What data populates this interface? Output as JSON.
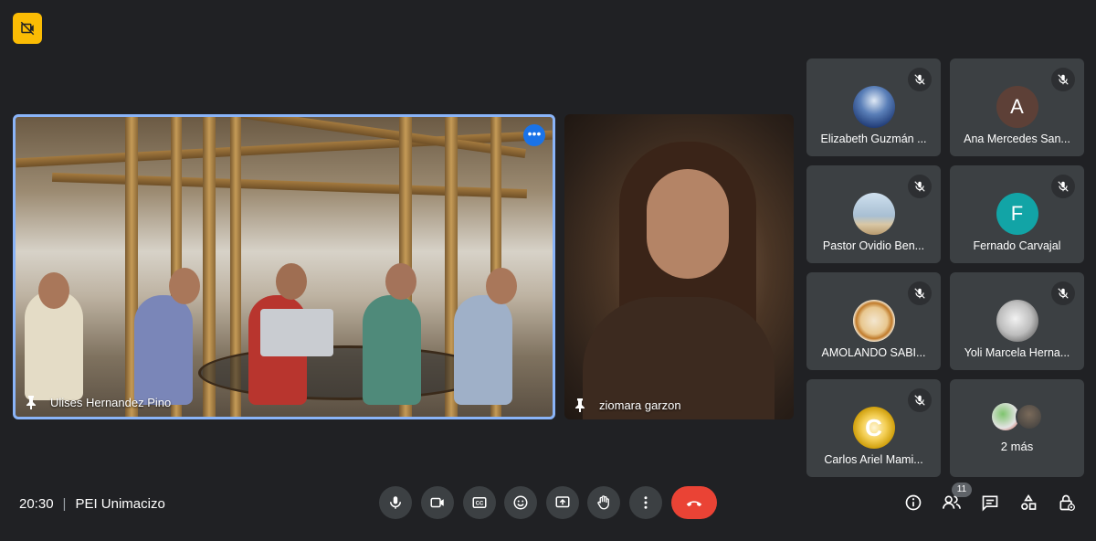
{
  "main_tile": {
    "name": "Ulises Hernandez Pino",
    "more_label": "•••"
  },
  "second_tile": {
    "name": "ziomara garzon"
  },
  "participants": [
    {
      "name": "Elizabeth Guzmán ...",
      "avatar_letter": "",
      "avatar_color": "#1f3a75"
    },
    {
      "name": "Ana Mercedes San...",
      "avatar_letter": "A",
      "avatar_color": "#5d4037"
    },
    {
      "name": "Pastor Ovidio Ben...",
      "avatar_letter": "",
      "avatar_color": "#9db3c9"
    },
    {
      "name": "Fernado Carvajal",
      "avatar_letter": "F",
      "avatar_color": "#12a4a6"
    },
    {
      "name": "AMOLANDO SABI...",
      "avatar_letter": "",
      "avatar_color": "#f3e6cf"
    },
    {
      "name": "Yoli Marcela Herna...",
      "avatar_letter": "",
      "avatar_color": "#d9d9d9"
    },
    {
      "name": "Carlos Ariel Mami...",
      "avatar_letter": "C",
      "avatar_color": "#d4a017"
    }
  ],
  "more_tile": {
    "label": "2 más"
  },
  "meeting": {
    "time": "20:30",
    "separator": "|",
    "code": "PEI Unimacizo"
  },
  "people_count": "11",
  "colors": {
    "background": "#202124",
    "tile": "#3c4043",
    "accent": "#8ab4f8",
    "end_call": "#ea4335",
    "recording": "#fbbc04"
  },
  "icons": {
    "recording": "no-camera-icon",
    "controls": [
      "mic-icon",
      "camera-icon",
      "captions-icon",
      "emoji-icon",
      "present-icon",
      "raise-hand-icon",
      "more-options-icon",
      "end-call-icon"
    ],
    "right": [
      "info-icon",
      "people-icon",
      "chat-icon",
      "activities-icon",
      "host-controls-icon"
    ]
  }
}
